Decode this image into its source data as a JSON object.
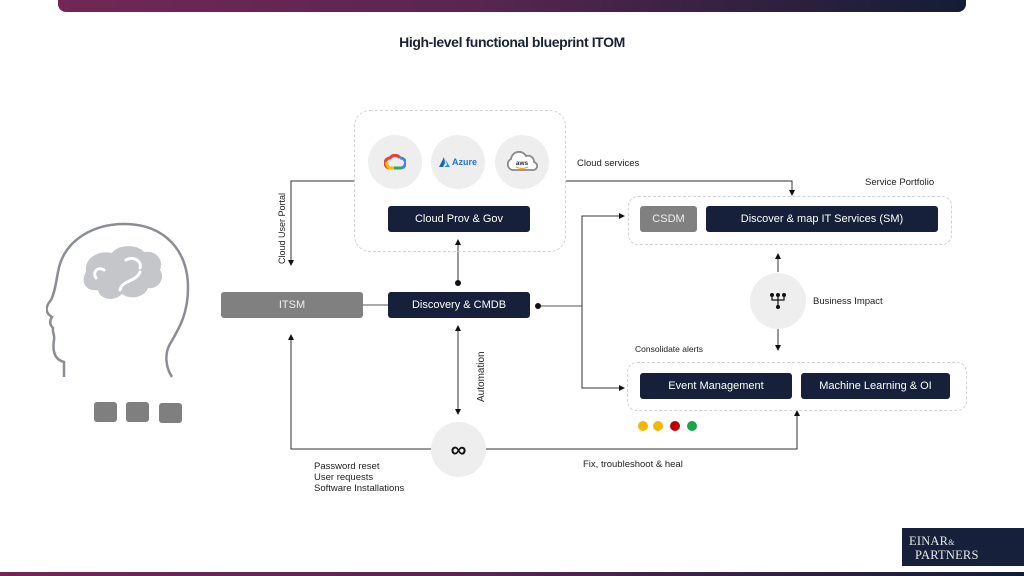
{
  "title": "High-level functional blueprint ITOM",
  "brand": {
    "colors": {
      "navy": "#16203a",
      "plum": "#722755",
      "gray_box": "#808080",
      "circle_bg": "#eeeeee"
    },
    "logo_line1": "EINAR",
    "logo_amp": "&",
    "logo_line2": "PARTNERS"
  },
  "cloud_group": {
    "providers": [
      {
        "name": "Google Cloud",
        "icon": "google-cloud-icon"
      },
      {
        "name": "Azure",
        "icon": "azure-icon",
        "text": "Azure"
      },
      {
        "name": "AWS",
        "icon": "aws-icon",
        "text": "aws"
      }
    ],
    "box_label": "Cloud Prov & Gov"
  },
  "nodes": {
    "itsm": "ITSM",
    "discovery": "Discovery & CMDB",
    "csdm": "CSDM",
    "discover_map": "Discover & map IT Services (SM)",
    "event_mgmt": "Event Management",
    "ml_oi": "Machine Learning & OI"
  },
  "labels": {
    "cloud_services": "Cloud services",
    "service_portfolio": "Service  Portfolio",
    "cloud_user_portal": "Cloud User Portal",
    "business_impact": "Business Impact",
    "consolidate_alerts": "Consolidate  alerts",
    "automation": "Automation",
    "fix_heal": "Fix,  troubleshoot & heal",
    "requests": [
      "Password reset",
      "User requests",
      "Software Installations"
    ]
  },
  "icons": {
    "head": "head-brain-icon",
    "hierarchy": "hierarchy-icon",
    "infinity": "infinity-icon",
    "infinity_glyph": "∞"
  },
  "status_dots": [
    {
      "state": "warning",
      "color": "#f5b800"
    },
    {
      "state": "warning",
      "color": "#f5b800"
    },
    {
      "state": "critical",
      "color": "#c00000"
    },
    {
      "state": "ok",
      "color": "#1aa34a"
    }
  ]
}
